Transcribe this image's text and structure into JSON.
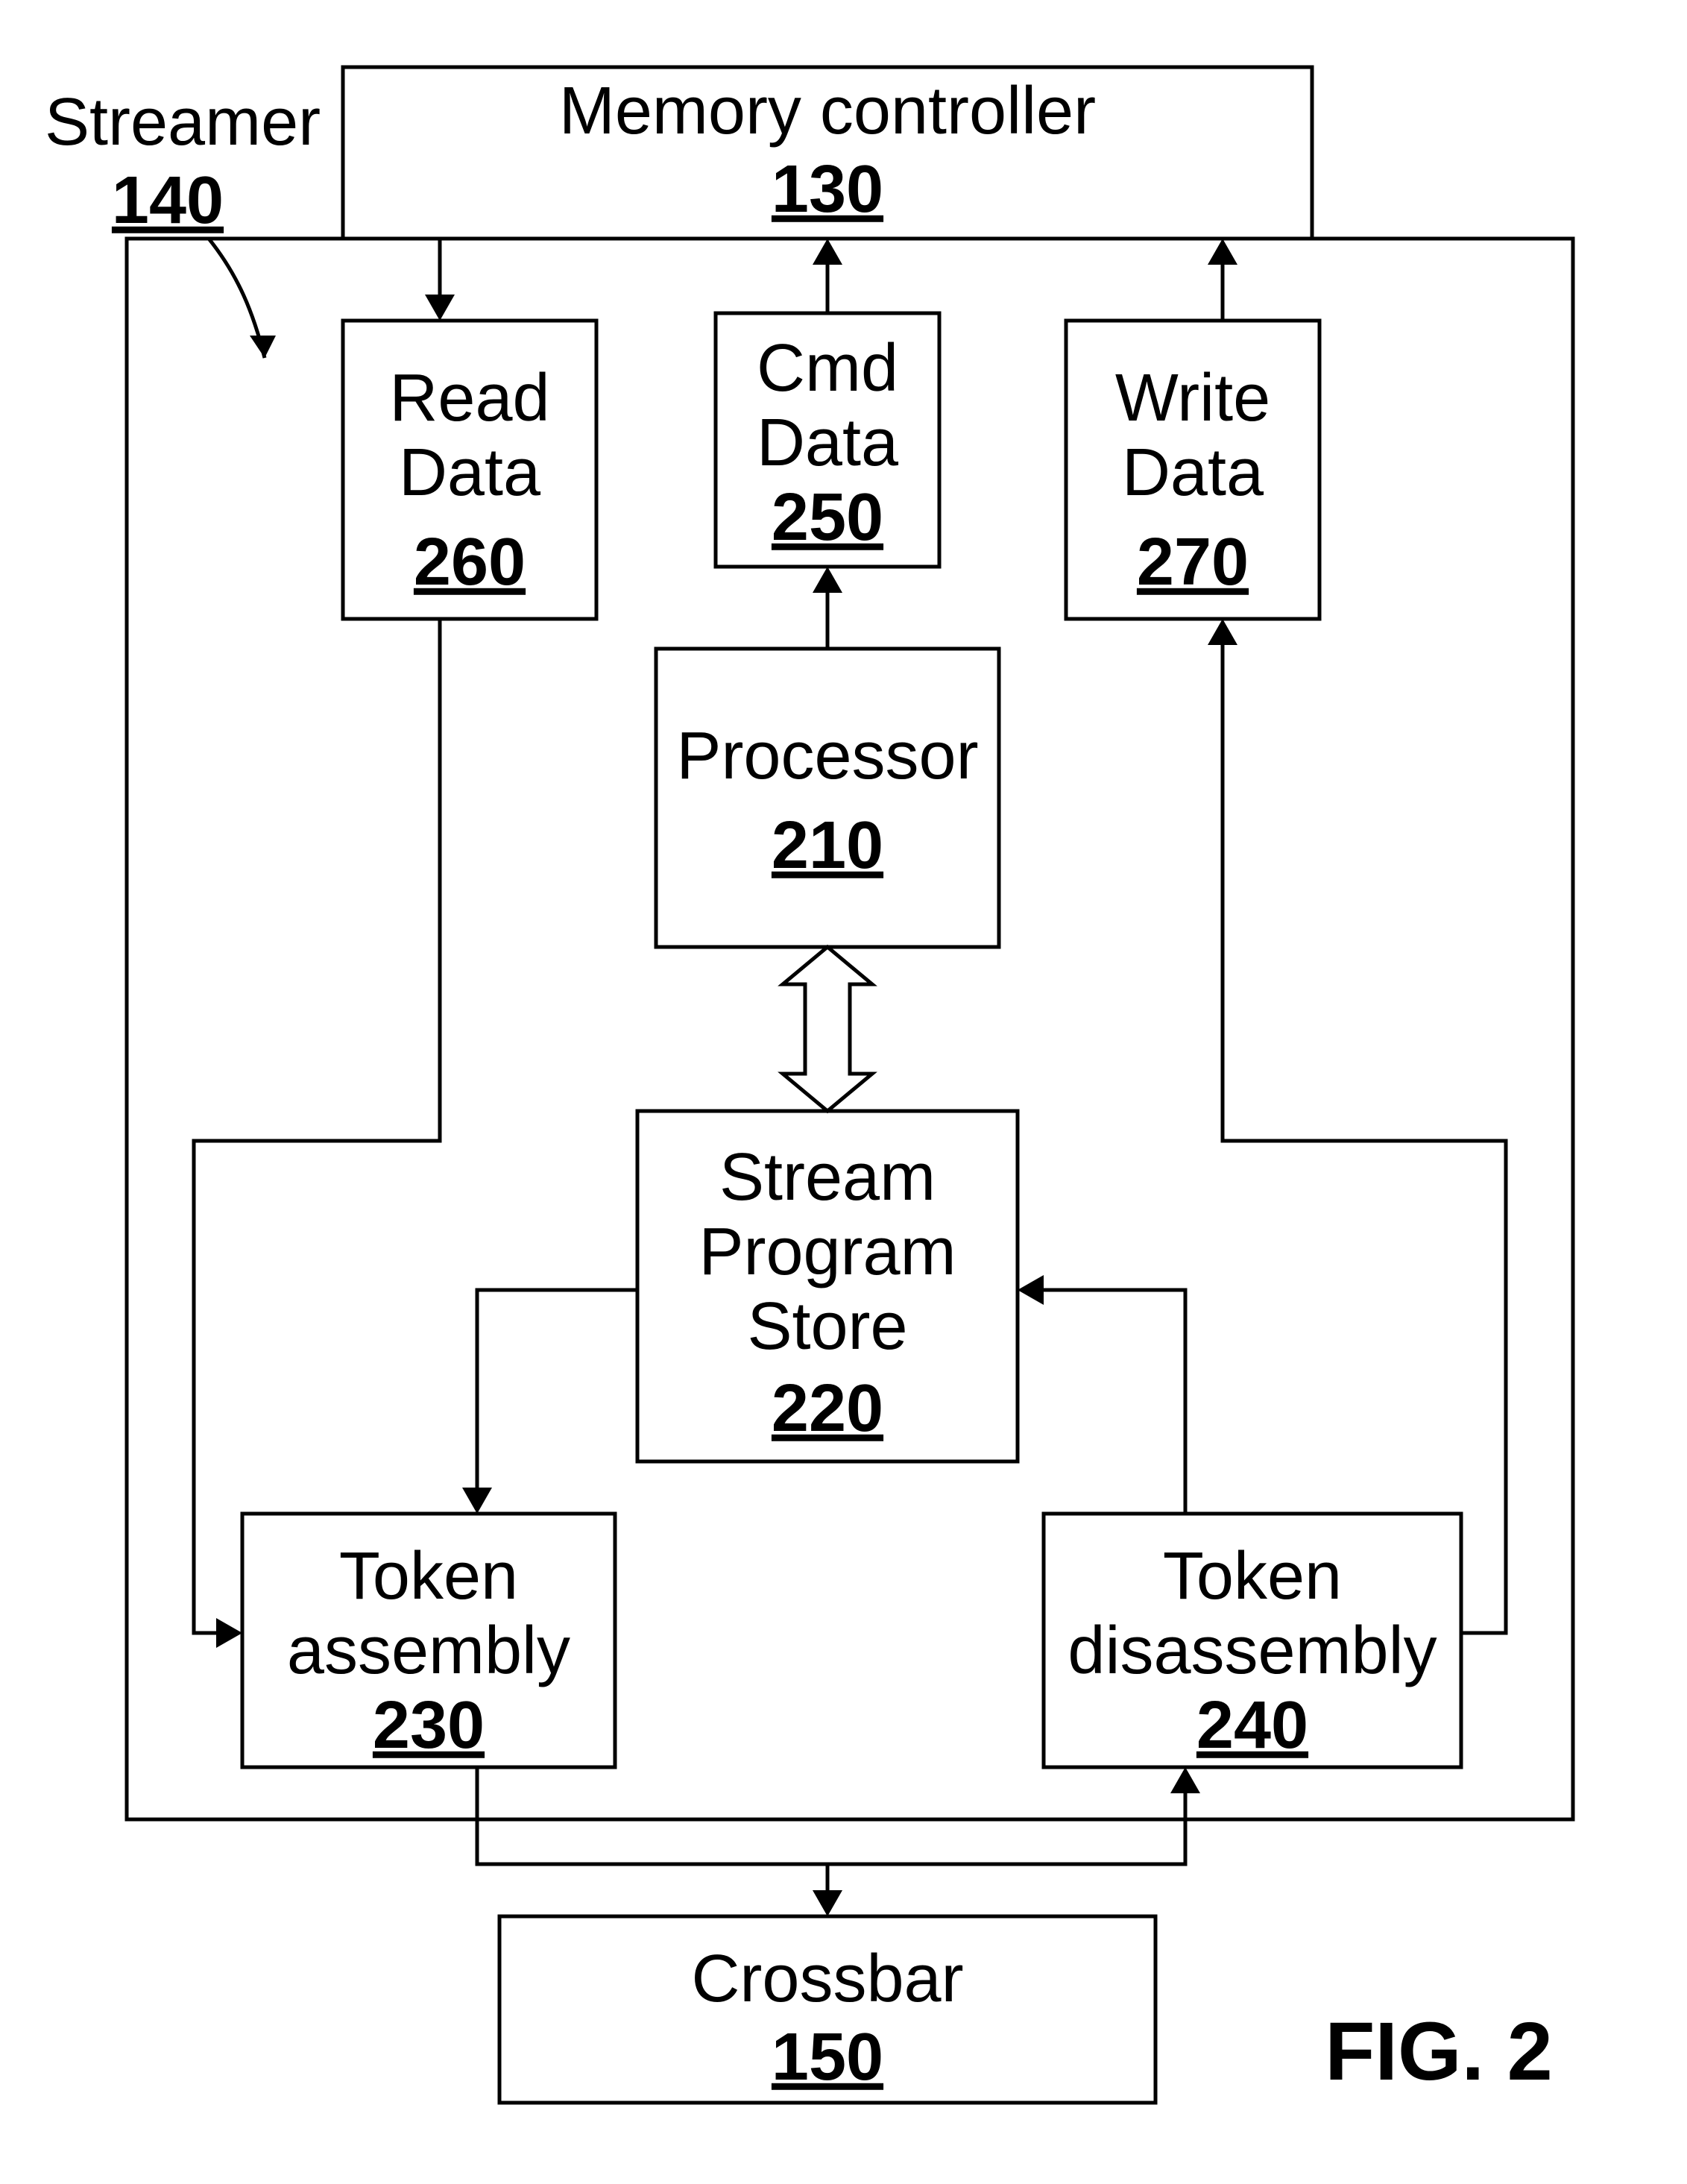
{
  "figure_label": "FIG. 2",
  "external_label": {
    "name": "Streamer",
    "ref": "140"
  },
  "blocks": {
    "memory_controller": {
      "label": "Memory controller",
      "ref": "130"
    },
    "read_data": {
      "line1": "Read",
      "line2": "Data",
      "ref": "260"
    },
    "cmd_data": {
      "line1": "Cmd",
      "line2": "Data",
      "ref": "250"
    },
    "write_data": {
      "line1": "Write",
      "line2": "Data",
      "ref": "270"
    },
    "processor": {
      "label": "Processor",
      "ref": "210"
    },
    "stream_store": {
      "line1": "Stream",
      "line2": "Program",
      "line3": "Store",
      "ref": "220"
    },
    "token_assembly": {
      "line1": "Token",
      "line2": "assembly",
      "ref": "230"
    },
    "token_disassembly": {
      "line1": "Token",
      "line2": "disassembly",
      "ref": "240"
    },
    "crossbar": {
      "label": "Crossbar",
      "ref": "150"
    }
  },
  "chart_data": {
    "type": "diagram",
    "nodes": [
      {
        "id": "memory_controller",
        "label": "Memory controller",
        "ref": "130"
      },
      {
        "id": "streamer",
        "label": "Streamer",
        "ref": "140",
        "container": true,
        "contains": [
          "read_data",
          "cmd_data",
          "write_data",
          "processor",
          "stream_store",
          "token_assembly",
          "token_disassembly"
        ]
      },
      {
        "id": "read_data",
        "label": "Read Data",
        "ref": "260"
      },
      {
        "id": "cmd_data",
        "label": "Cmd Data",
        "ref": "250"
      },
      {
        "id": "write_data",
        "label": "Write Data",
        "ref": "270"
      },
      {
        "id": "processor",
        "label": "Processor",
        "ref": "210"
      },
      {
        "id": "stream_store",
        "label": "Stream Program Store",
        "ref": "220"
      },
      {
        "id": "token_assembly",
        "label": "Token assembly",
        "ref": "230"
      },
      {
        "id": "token_disassembly",
        "label": "Token disassembly",
        "ref": "240"
      },
      {
        "id": "crossbar",
        "label": "Crossbar",
        "ref": "150"
      }
    ],
    "edges": [
      {
        "from": "memory_controller",
        "to": "read_data",
        "dir": "forward"
      },
      {
        "from": "cmd_data",
        "to": "memory_controller",
        "dir": "forward"
      },
      {
        "from": "write_data",
        "to": "memory_controller",
        "dir": "forward"
      },
      {
        "from": "processor",
        "to": "cmd_data",
        "dir": "forward"
      },
      {
        "from": "processor",
        "to": "stream_store",
        "dir": "both"
      },
      {
        "from": "stream_store",
        "to": "token_assembly",
        "dir": "forward"
      },
      {
        "from": "token_disassembly",
        "to": "stream_store",
        "dir": "forward"
      },
      {
        "from": "read_data",
        "to": "token_assembly",
        "dir": "forward",
        "via": "left-bus"
      },
      {
        "from": "token_disassembly",
        "to": "write_data",
        "dir": "forward",
        "via": "right-bus"
      },
      {
        "from": "token_assembly",
        "to": "crossbar",
        "dir": "forward"
      },
      {
        "from": "crossbar",
        "to": "token_disassembly",
        "dir": "forward"
      }
    ]
  }
}
